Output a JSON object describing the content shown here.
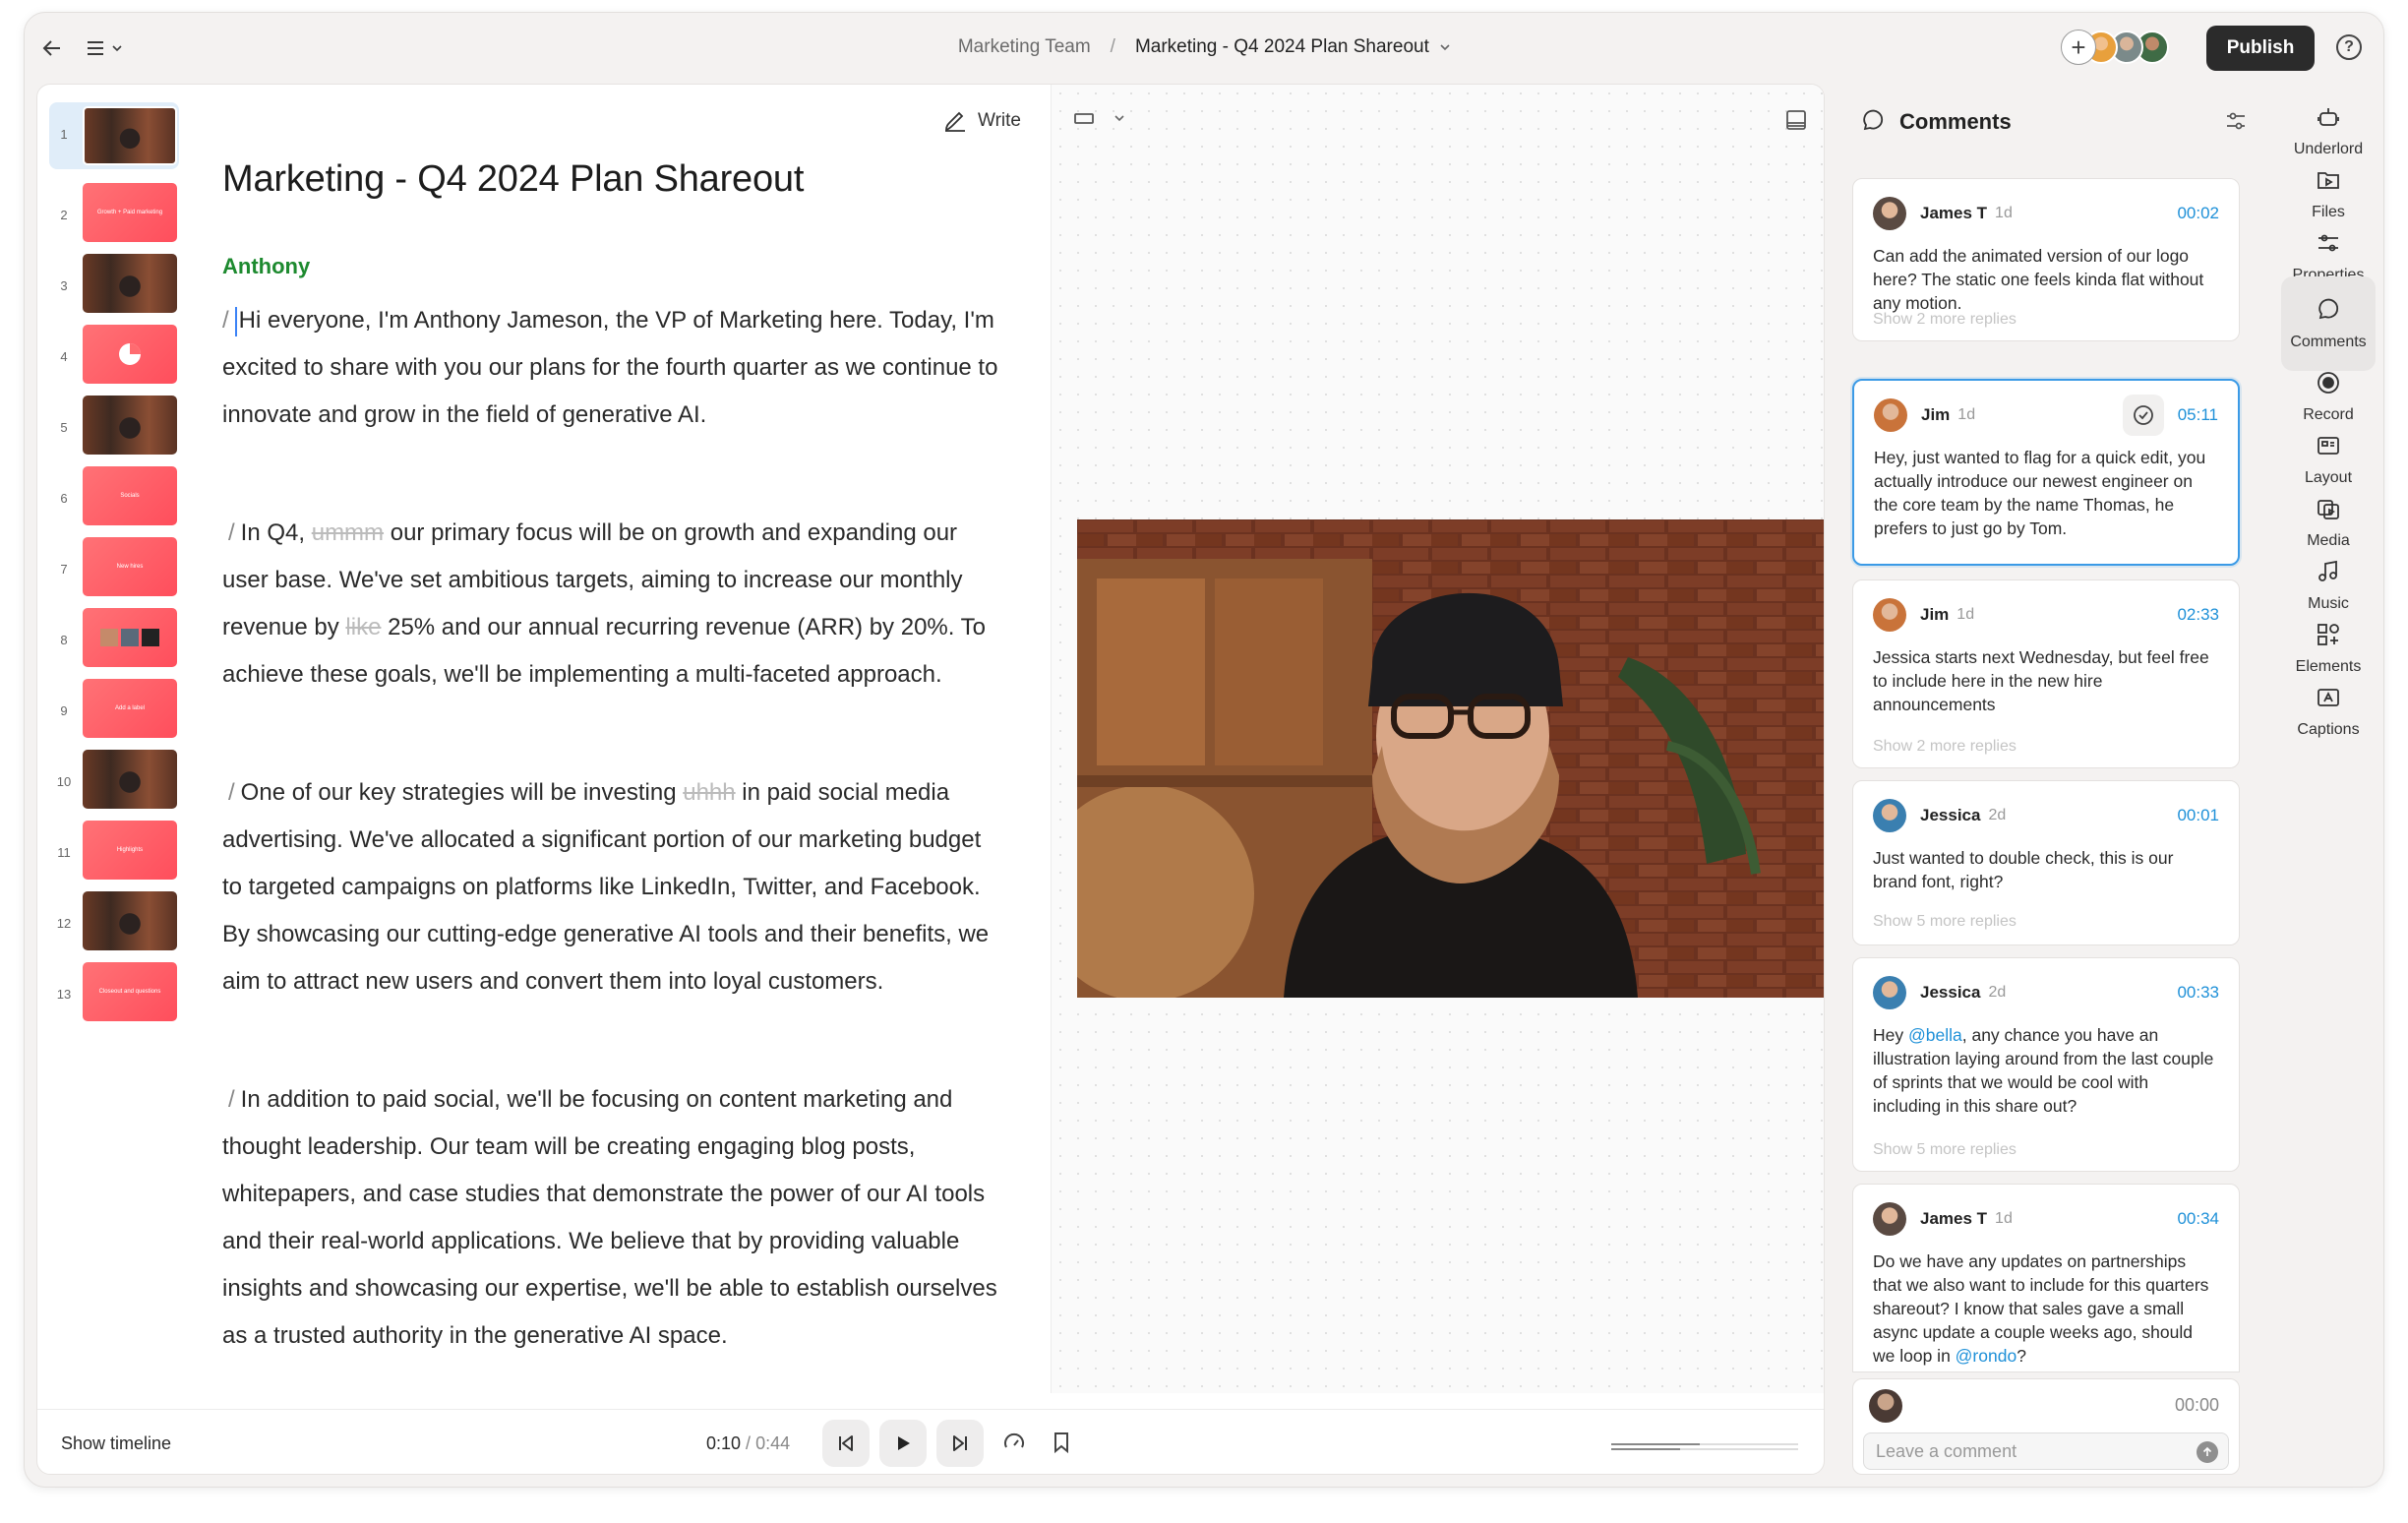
{
  "breadcrumb": {
    "team": "Marketing Team",
    "separator": "/",
    "project": "Marketing - Q4 2024 Plan Shareout"
  },
  "toolbar": {
    "publish_label": "Publish",
    "help_label": "?",
    "add_collab_label": "+"
  },
  "script": {
    "write_label": "Write",
    "title": "Marketing - Q4 2024 Plan Shareout",
    "speaker": "Anthony",
    "paragraphs": [
      {
        "slash": "/",
        "pre": "Hi everyone, I'm Anthony Jameson, the VP of Marketing here. Today, I'm excited to share with you our plans for the fourth quarter as we continue to innovate and grow in the field of generative AI."
      },
      {
        "slash": "/",
        "pre": "In Q4, ",
        "strike": "ummm",
        "post": " our primary focus will be on growth and expanding our user base. We've set ambitious targets, aiming to increase our monthly revenue by ",
        "strike2": "like",
        "post2": " 25% and our annual recurring revenue (ARR) by 20%. To achieve these goals, we'll be implementing a multi-faceted approach."
      },
      {
        "slash": "/",
        "pre": "One of our key strategies will be investing ",
        "strike": "uhhh",
        "post": " in paid social media advertising. We've allocated a significant portion of our marketing budget to targeted campaigns on platforms like LinkedIn, Twitter, and Facebook. By showcasing our cutting-edge generative AI tools and their benefits, we aim to attract new users and convert them into loyal customers."
      },
      {
        "slash": "/",
        "pre": "In addition to paid social, we'll be focusing on content marketing and thought leadership. Our team will be creating engaging blog posts, whitepapers, and case studies that demonstrate the power of our AI tools and their real-world applications. We believe that by providing valuable insights and showcasing our expertise, we'll be able to establish ourselves as a trusted authority in the generative AI space."
      }
    ]
  },
  "scenes": [
    {
      "num": "1",
      "kind": "video",
      "label": ""
    },
    {
      "num": "2",
      "kind": "pink",
      "label": "Growth + Paid marketing"
    },
    {
      "num": "3",
      "kind": "video",
      "label": ""
    },
    {
      "num": "4",
      "kind": "pie",
      "label": ""
    },
    {
      "num": "5",
      "kind": "video",
      "label": ""
    },
    {
      "num": "6",
      "kind": "pink",
      "label": "Socials"
    },
    {
      "num": "7",
      "kind": "pink",
      "label": "New hires"
    },
    {
      "num": "8",
      "kind": "photos",
      "label": ""
    },
    {
      "num": "9",
      "kind": "pink",
      "label": "Add a label"
    },
    {
      "num": "10",
      "kind": "video",
      "label": ""
    },
    {
      "num": "11",
      "kind": "pink",
      "label": "Highlights"
    },
    {
      "num": "12",
      "kind": "video",
      "label": ""
    },
    {
      "num": "13",
      "kind": "pink",
      "label": "Closeout and questions"
    }
  ],
  "transport": {
    "show_timeline": "Show timeline",
    "current": "0:10",
    "sep": " / ",
    "duration": "0:44"
  },
  "comments": {
    "header": "Comments",
    "items": [
      {
        "who": "James T",
        "ago": "1d",
        "ts": "00:02",
        "body": "Can add the animated version of our logo here? The static one feels kinda flat without any motion.",
        "more": "Show 2 more replies",
        "avatar": "#5a4a42"
      },
      {
        "who": "Jim",
        "ago": "1d",
        "ts": "05:11",
        "body": "Hey, just wanted to flag for a quick edit, you actually introduce our newest engineer on the core team by the name Thomas, he prefers to just go by Tom.",
        "more": "",
        "avatar": "#c9733a"
      },
      {
        "who": "Jim",
        "ago": "1d",
        "ts": "02:33",
        "body": "Jessica starts next Wednesday, but feel free to include here in the new hire announcements",
        "more": "Show 2 more replies",
        "avatar": "#c9733a"
      },
      {
        "who": "Jessica",
        "ago": "2d",
        "ts": "00:01",
        "body": "Just wanted to double check, this is our brand font, right?",
        "more": "Show 5 more replies",
        "avatar": "#3a7fb0"
      },
      {
        "who": "Jessica",
        "ago": "2d",
        "ts": "00:33",
        "body_pre": "Hey ",
        "mention": "@bella",
        "body_post": ", any chance you have an illustration laying around from the last couple of sprints that we would be cool with including in this share out?",
        "more": "Show 5 more replies",
        "avatar": "#3a7fb0"
      },
      {
        "who": "James T",
        "ago": "1d",
        "ts": "00:34",
        "body_pre": "Do we have any updates on partnerships that we also want to include for this quarters shareout? I know that sales gave a small async update a couple weeks ago, should we loop in ",
        "mention": "@rondo",
        "body_post": "?",
        "more": "",
        "avatar": "#5a4a42"
      }
    ],
    "compose": {
      "time": "00:00",
      "placeholder": "Leave a comment",
      "send_icon": "arrow-up-icon"
    }
  },
  "rail": [
    {
      "label": "Underlord",
      "icon": "robot-icon"
    },
    {
      "label": "Files",
      "icon": "folder-play-icon"
    },
    {
      "label": "Properties",
      "icon": "sliders-icon"
    },
    {
      "label": "Comments",
      "icon": "comment-icon",
      "active": true
    },
    {
      "label": "Record",
      "icon": "record-icon"
    },
    {
      "label": "Layout",
      "icon": "layout-icon"
    },
    {
      "label": "Media",
      "icon": "media-icon"
    },
    {
      "label": "Music",
      "icon": "music-icon"
    },
    {
      "label": "Elements",
      "icon": "elements-icon"
    },
    {
      "label": "Captions",
      "icon": "captions-icon"
    }
  ],
  "colors": {
    "accent": "#1e90d8",
    "speaker": "#1d8a2f",
    "publish_bg": "#2b2b2b",
    "scene_pink": "#ff5a63"
  }
}
